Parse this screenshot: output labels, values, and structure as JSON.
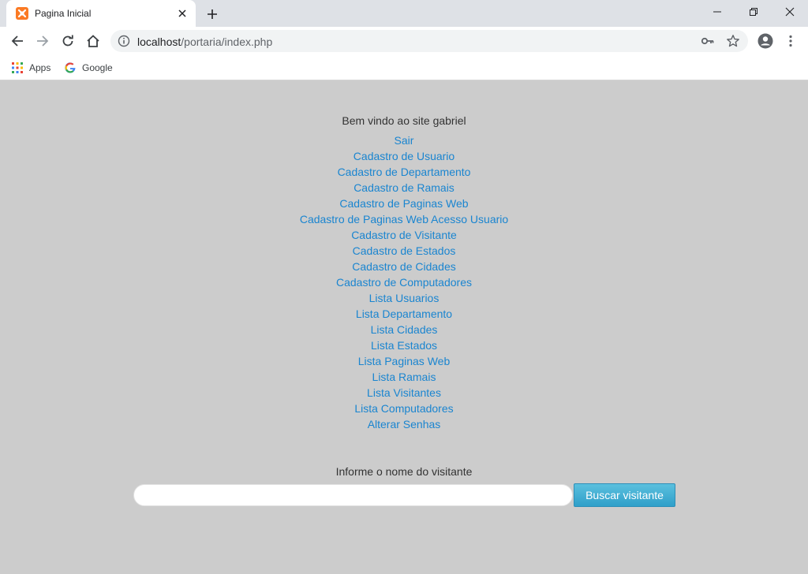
{
  "browser": {
    "tab": {
      "title": "Pagina Inicial",
      "favicon": "xampp-icon"
    },
    "address": {
      "host": "localhost",
      "path": "/portaria/index.php"
    },
    "bookmarks": [
      {
        "label": "Apps",
        "icon": "apps-grid-icon"
      },
      {
        "label": "Google",
        "icon": "google-icon"
      }
    ]
  },
  "page": {
    "welcome": "Bem vindo ao site gabriel",
    "links": [
      "Sair",
      "Cadastro de Usuario",
      "Cadastro de Departamento",
      "Cadastro de Ramais",
      "Cadastro de Paginas Web",
      "Cadastro de Paginas Web Acesso Usuario",
      "Cadastro de Visitante",
      "Cadastro de Estados",
      "Cadastro de Cidades",
      "Cadastro de Computadores",
      "Lista Usuarios",
      "Lista Departamento",
      "Lista Cidades",
      "Lista Estados",
      "Lista Paginas Web",
      "Lista Ramais",
      "Lista Visitantes",
      "Lista Computadores",
      "Alterar Senhas"
    ],
    "visitor_search": {
      "label": "Informe o nome do visitante",
      "value": "",
      "placeholder": "",
      "button": "Buscar visitante"
    }
  },
  "colors": {
    "page_background": "#cccccc",
    "link": "#1a85d0",
    "button": "#31a3cf",
    "tab_favicon": "#fb7a24"
  }
}
